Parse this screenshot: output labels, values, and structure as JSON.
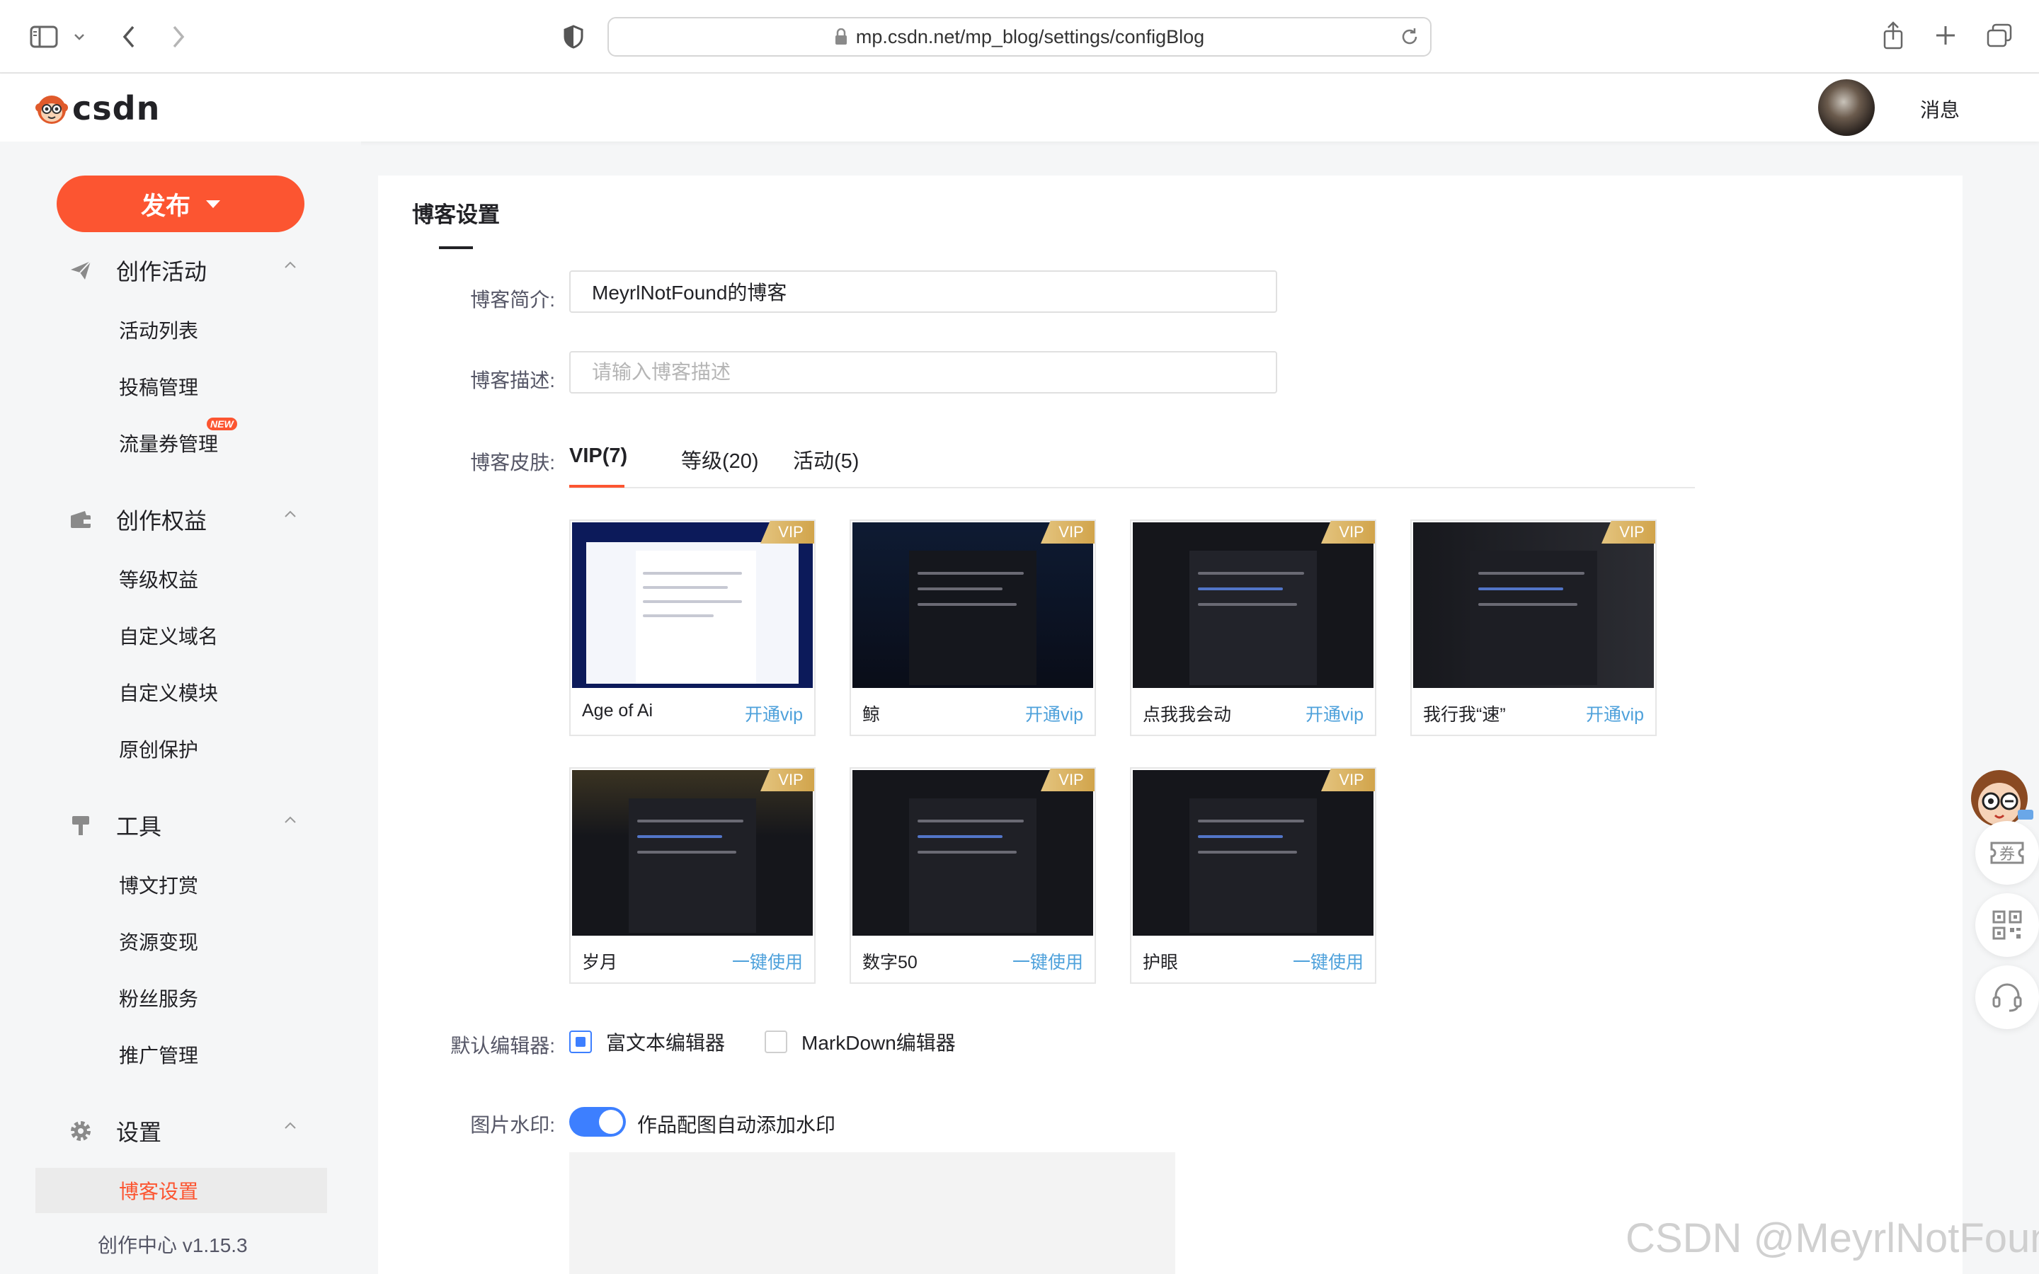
{
  "browser": {
    "url": "mp.csdn.net/mp_blog/settings/configBlog"
  },
  "header": {
    "logo_text": "csdn",
    "messages_label": "消息"
  },
  "sidebar": {
    "publish_label": "发布",
    "groups": [
      {
        "label": "创作活动",
        "icon": "paper-plane-icon",
        "items": [
          "活动列表",
          "投稿管理",
          "流量券管理"
        ]
      },
      {
        "label": "创作权益",
        "icon": "wallet-icon",
        "items": [
          "等级权益",
          "自定义域名",
          "自定义模块",
          "原创保护"
        ]
      },
      {
        "label": "工具",
        "icon": "hammer-icon",
        "items": [
          "博文打赏",
          "资源变现",
          "粉丝服务",
          "推广管理"
        ]
      },
      {
        "label": "设置",
        "icon": "gear-icon",
        "items": [
          "博客设置"
        ]
      }
    ],
    "new_badge": "NEW",
    "active_item": "博客设置",
    "version": "创作中心 v1.15.3"
  },
  "main": {
    "title": "博客设置",
    "intro_label": "博客简介:",
    "intro_value": "MeyrlNotFound的博客",
    "desc_label": "博客描述:",
    "desc_placeholder": "请输入博客描述",
    "skin_label": "博客皮肤:",
    "tabs": [
      "VIP(7)",
      "等级(20)",
      "活动(5)"
    ],
    "skins": [
      {
        "name": "Age of Ai",
        "action": "开通vip",
        "tag": "VIP"
      },
      {
        "name": "鲸",
        "action": "开通vip",
        "tag": "VIP"
      },
      {
        "name": "点我我会动",
        "action": "开通vip",
        "tag": "VIP"
      },
      {
        "name": "我行我“速”",
        "action": "开通vip",
        "tag": "VIP"
      },
      {
        "name": "岁月",
        "action": "一键使用",
        "tag": "VIP"
      },
      {
        "name": "数字50",
        "action": "一键使用",
        "tag": "VIP"
      },
      {
        "name": "护眼",
        "action": "一键使用",
        "tag": "VIP"
      }
    ],
    "editor_label": "默认编辑器:",
    "editor_options": [
      "富文本编辑器",
      "MarkDown编辑器"
    ],
    "editor_selected": "富文本编辑器",
    "watermark_label": "图片水印:",
    "watermark_toggle_label": "作品配图自动添加水印",
    "watermark_on": true
  },
  "float": {
    "coupon_icon_text": "券"
  },
  "page_watermark": "CSDN @MeyrlNotFound",
  "colors": {
    "brand": "#fc5531",
    "accent_blue": "#3d7fff",
    "link_blue": "#4ea1db",
    "vip_gold": "#d1a44b"
  }
}
